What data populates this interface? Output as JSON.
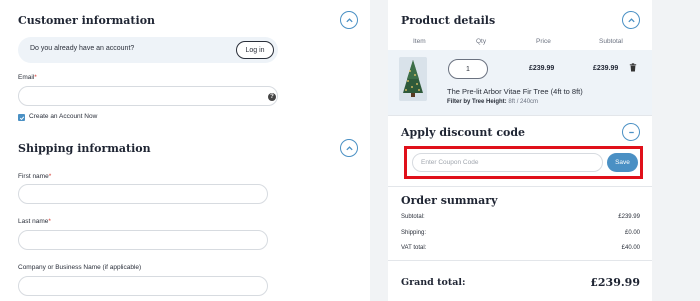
{
  "customer": {
    "title": "Customer information",
    "account_question": "Do you already have an account?",
    "login_label": "Log in",
    "email_label": "Email",
    "email_value": "",
    "create_account_label": "Create an Account Now",
    "create_account_checked": true
  },
  "shipping": {
    "title": "Shipping information",
    "first_name_label": "First name",
    "first_name_value": "",
    "last_name_label": "Last name",
    "last_name_value": "",
    "company_label": "Company or Business Name (if applicable)",
    "company_value": ""
  },
  "product": {
    "title": "Product details",
    "columns": [
      "Item",
      "Qty",
      "Price",
      "Subtotal"
    ],
    "qty": "1",
    "price": "£239.99",
    "subtotal": "£239.99",
    "name": "The Pre-lit Arbor Vitae Fir Tree (4ft to 8ft)",
    "filter_label": "Filter by Tree Height:",
    "filter_value": "8ft / 240cm"
  },
  "discount": {
    "title": "Apply discount code",
    "placeholder": "Enter Coupon Code",
    "save_label": "Save"
  },
  "summary": {
    "title": "Order summary",
    "subtotal_label": "Subtotal:",
    "subtotal_value": "£239.99",
    "shipping_label": "Shipping:",
    "shipping_value": "£0.00",
    "vat_label": "VAT total:",
    "vat_value": "£40.00",
    "grand_label": "Grand total:",
    "grand_value": "£239.99"
  },
  "colors": {
    "accent": "#4a90c4",
    "highlight_border": "#e0101a",
    "required": "#d4342a"
  },
  "icons": [
    "chevron-up-icon",
    "help-icon",
    "check-icon",
    "trash-icon",
    "minus-icon"
  ]
}
